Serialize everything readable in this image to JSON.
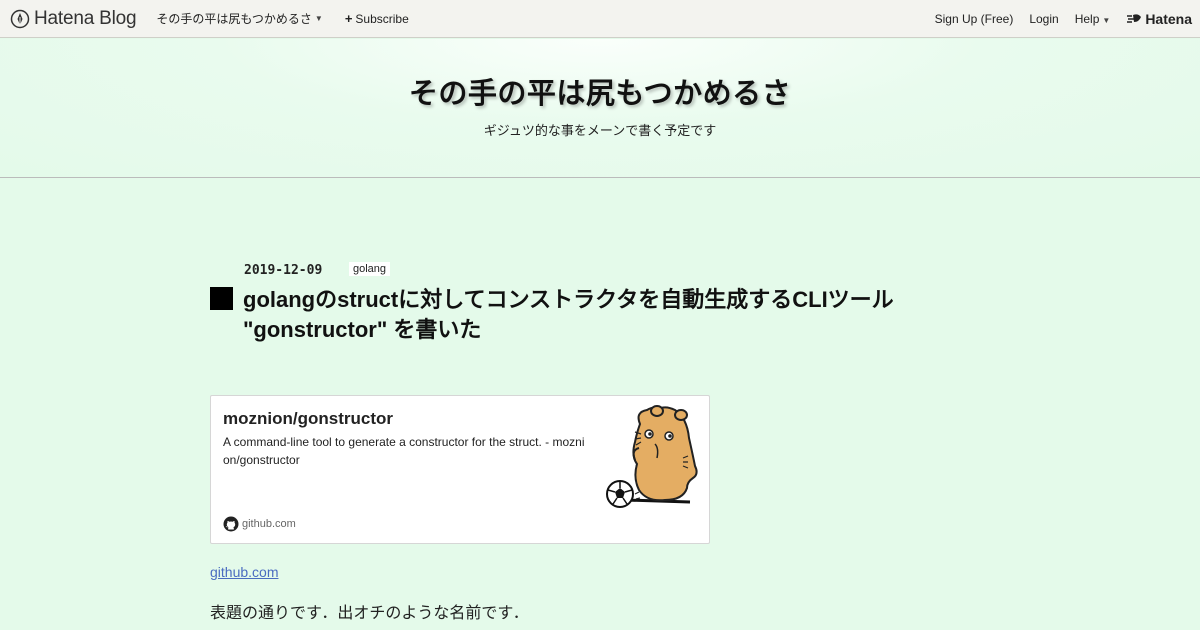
{
  "topbar": {
    "logo_text": "Hatena Blog",
    "blog_menu_label": "その手の平は尻もつかめるさ",
    "subscribe_label": "Subscribe",
    "signup_label": "Sign Up (Free)",
    "login_label": "Login",
    "help_label": "Help",
    "hatena_label": "Hatena"
  },
  "header": {
    "title": "その手の平は尻もつかめるさ",
    "description": "ギジュツ的な事をメーンで書く予定です"
  },
  "entry": {
    "date": "2019-12-09",
    "category": "golang",
    "title_line1": "golangのstructに対してコンストラクタを自動生成するCLIツール",
    "title_line2": "\"gonstructor\" を書いた"
  },
  "embed_card": {
    "title": "moznion/gonstructor",
    "description": "A command-line tool to generate a constructor for the struct. - moznion/gonstructor",
    "source": "github.com",
    "image_icon": "cartoon-hamster-kicking-soccer-ball"
  },
  "content": {
    "link_text": "github.com",
    "paragraph": "表題の通りです．出オチのような名前です．"
  },
  "colors": {
    "page_background": "#e4faea",
    "link": "#4a6cc0",
    "title_mark": "#000000"
  }
}
